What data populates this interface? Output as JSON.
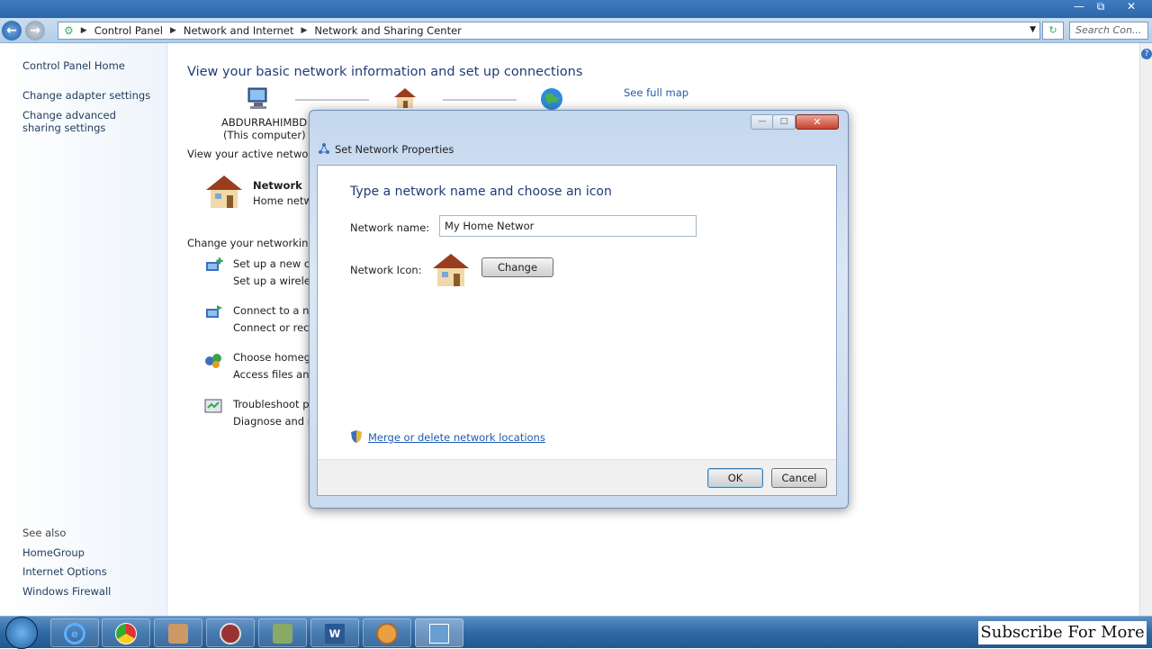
{
  "window": {
    "breadcrumbs": [
      "Control Panel",
      "Network and Internet",
      "Network and Sharing Center"
    ],
    "search_placeholder": "Search Con..."
  },
  "left_pane": {
    "home": "Control Panel Home",
    "links": [
      "Change adapter settings",
      "Change advanced sharing settings"
    ],
    "see_also_label": "See also",
    "see_also": [
      "HomeGroup",
      "Internet Options",
      "Windows Firewall"
    ]
  },
  "main": {
    "heading": "View your basic network information and set up connections",
    "computer_name": "ABDURRAHIMBD",
    "computer_sub": "(This computer)",
    "see_full_map": "See full map",
    "active_networks_label": "View your active networks",
    "network_name": "Network",
    "network_type": "Home netw",
    "change_settings_label": "Change your networking se",
    "tasks": [
      {
        "title": "Set up a new con",
        "desc": "Set up a wireless,"
      },
      {
        "title": "Connect to a net",
        "desc": "Connect or recon"
      },
      {
        "title": "Choose homegro",
        "desc": "Access files and p"
      },
      {
        "title": "Troubleshoot pro",
        "desc": "Diagnose and rep"
      }
    ]
  },
  "dialog": {
    "title": "Set Network Properties",
    "heading": "Type a network name and choose an icon",
    "name_label": "Network name:",
    "name_value": "My Home Networ",
    "icon_label": "Network Icon:",
    "change_button": "Change",
    "merge_link": "Merge or delete network locations",
    "ok_button": "OK",
    "cancel_button": "Cancel"
  },
  "overlay": {
    "subscribe": "Subscribe For More"
  },
  "colors": {
    "link": "#1e5cb3",
    "heading": "#1e3c78",
    "taskbar": "#2f6aa6"
  }
}
